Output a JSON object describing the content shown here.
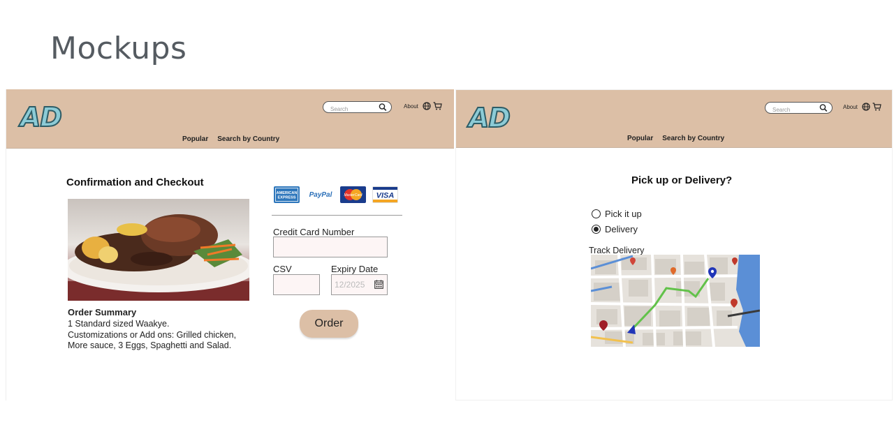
{
  "slide": {
    "title": "Mockups"
  },
  "header": {
    "logo_text": "AD",
    "search_placeholder": "Search",
    "about_label": "About",
    "nav": [
      "Popular",
      "Search by Country"
    ]
  },
  "checkout": {
    "title": "Confirmation and Checkout",
    "payment_methods": [
      {
        "name": "American Express",
        "text": "AMERICAN EXPRESS",
        "color": "#2e77bc"
      },
      {
        "name": "PayPal",
        "text": "PayPal",
        "color": "#ffffff"
      },
      {
        "name": "MasterCard",
        "text": "MasterCard",
        "color": "#1a3c8c"
      },
      {
        "name": "Visa",
        "text": "VISA",
        "color": "#ffffff"
      }
    ],
    "credit_card_label": "Credit Card Number",
    "credit_card_value": "",
    "csv_label": "CSV",
    "csv_value": "",
    "expiry_label": "Expiry Date",
    "expiry_placeholder": "12/2025",
    "order_button": "Order",
    "order_summary": {
      "title": "Order Summary",
      "lines": [
        "1 Standard sized Waakye.",
        "Customizations or Add ons: Grilled chicken,",
        "More sauce, 3 Eggs, Spaghetti and Salad."
      ]
    }
  },
  "delivery": {
    "title": "Pick up or Delivery?",
    "options": [
      {
        "label": "Pick it up",
        "selected": false
      },
      {
        "label": "Delivery",
        "selected": true
      }
    ],
    "track_label": "Track Delivery"
  },
  "colors": {
    "header_bg": "#dcbfa6",
    "button_bg": "#dcbfa6",
    "logo_fill": "#8ccbd6",
    "logo_stroke": "#2d5c66",
    "input_bg": "#fdf5f5"
  }
}
